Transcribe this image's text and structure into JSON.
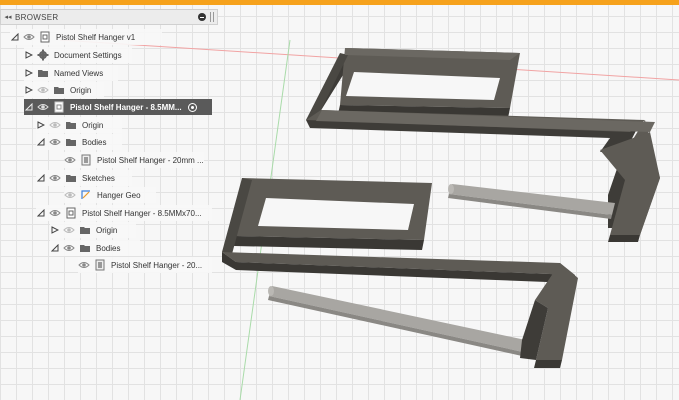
{
  "browser": {
    "title": "BROWSER",
    "collapse_glyph": "◂◂",
    "rows": [
      {
        "label": "Pistol Shelf Hanger v1"
      },
      {
        "label": "Document Settings"
      },
      {
        "label": "Named Views"
      },
      {
        "label": "Origin"
      },
      {
        "label": "Pistol Shelf Hanger - 8.5MM..."
      },
      {
        "label": "Origin"
      },
      {
        "label": "Bodies"
      },
      {
        "label": "Pistol Shelf Hanger - 20mm ..."
      },
      {
        "label": "Sketches"
      },
      {
        "label": "Hanger Geo"
      },
      {
        "label": "Pistol Shelf Hanger - 8.5MMx70..."
      },
      {
        "label": "Origin"
      },
      {
        "label": "Bodies"
      },
      {
        "label": "Pistol Shelf Hanger - 20..."
      }
    ]
  },
  "colors": {
    "accent": "#f6a21c",
    "hanger_top": "#5e5b55",
    "hanger_side": "#3e3c38",
    "rod": "#a8a6a2",
    "selected_row": "#5a5a5a"
  },
  "icons": [
    "eye-icon",
    "folder-icon",
    "gear-icon",
    "component-icon",
    "body-icon",
    "sketch-icon"
  ]
}
